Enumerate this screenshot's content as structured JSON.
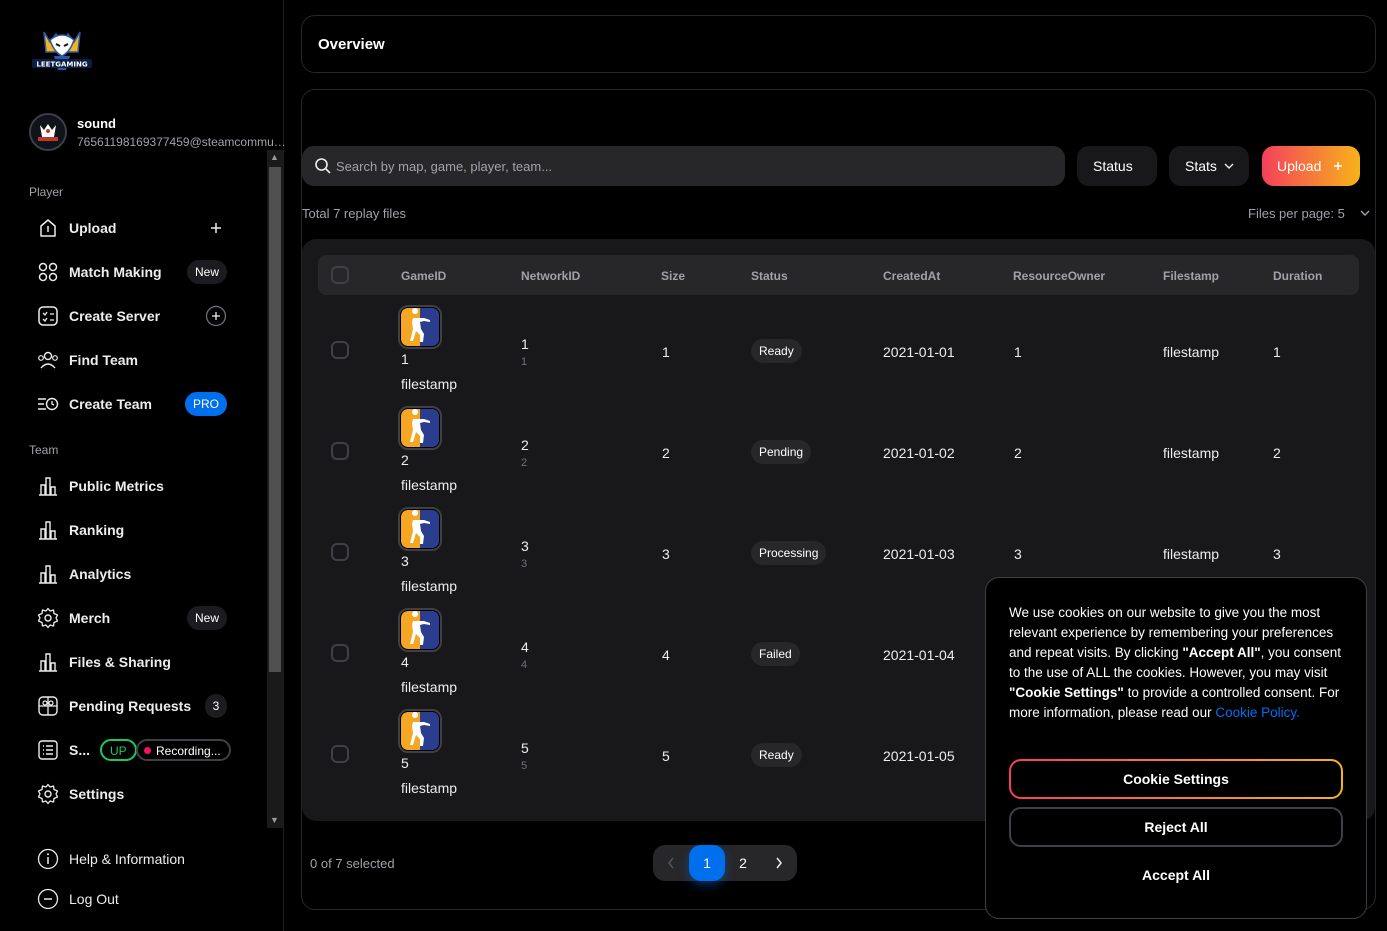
{
  "app": {
    "logo_text": "LEETGAMING"
  },
  "user": {
    "name": "sound",
    "email": "76561198169377459@steamcommunity.com"
  },
  "sidebar": {
    "player_section": "Player",
    "team_section": "Team",
    "player_items": [
      {
        "label": "Upload",
        "icon": "upload-icon"
      },
      {
        "label": "Match Making",
        "icon": "grid-icon",
        "badge": "New"
      },
      {
        "label": "Create Server",
        "icon": "checklist-icon"
      },
      {
        "label": "Find Team",
        "icon": "users-icon"
      },
      {
        "label": "Create Team",
        "icon": "list-clock-icon",
        "badge": "PRO"
      }
    ],
    "team_items": [
      {
        "label": "Public Metrics",
        "icon": "bar-chart-icon"
      },
      {
        "label": "Ranking",
        "icon": "bar-chart-icon"
      },
      {
        "label": "Analytics",
        "icon": "bar-chart-icon"
      },
      {
        "label": "Merch",
        "icon": "gear-icon",
        "badge": "New"
      },
      {
        "label": "Files & Sharing",
        "icon": "bar-chart-icon"
      },
      {
        "label": "Pending Requests",
        "icon": "gift-icon",
        "badge": "3"
      },
      {
        "label": "S...",
        "icon": "document-list-icon",
        "up_chip": "UP",
        "rec_chip": "Recording..."
      },
      {
        "label": "Settings",
        "icon": "gear-icon"
      }
    ],
    "footer_items": [
      {
        "label": "Help & Information",
        "icon": "info-icon"
      },
      {
        "label": "Log Out",
        "icon": "logout-icon"
      }
    ]
  },
  "overview": {
    "title": "Overview"
  },
  "toolbar": {
    "search_placeholder": "Search by map, game, player, team...",
    "status_label": "Status",
    "stats_label": "Stats",
    "upload_label": "Upload",
    "total_text": "Total 7 replay files",
    "per_page_text": "Files per page: 5"
  },
  "table": {
    "headers": [
      "GameID",
      "NetworkID",
      "Size",
      "Status",
      "CreatedAt",
      "ResourceOwner",
      "Filestamp",
      "Duration"
    ],
    "rows": [
      {
        "game_id": "1",
        "game_sub": "filestamp",
        "network_id": "1",
        "network_sub": "1",
        "size": "1",
        "status": "Ready",
        "created_at": "2021-01-01",
        "owner": "1",
        "filestamp": "filestamp",
        "duration": "1"
      },
      {
        "game_id": "2",
        "game_sub": "filestamp",
        "network_id": "2",
        "network_sub": "2",
        "size": "2",
        "status": "Pending",
        "created_at": "2021-01-02",
        "owner": "2",
        "filestamp": "filestamp",
        "duration": "2"
      },
      {
        "game_id": "3",
        "game_sub": "filestamp",
        "network_id": "3",
        "network_sub": "3",
        "size": "3",
        "status": "Processing",
        "created_at": "2021-01-03",
        "owner": "3",
        "filestamp": "filestamp",
        "duration": "3"
      },
      {
        "game_id": "4",
        "game_sub": "filestamp",
        "network_id": "4",
        "network_sub": "4",
        "size": "4",
        "status": "Failed",
        "created_at": "2021-01-04",
        "owner": "",
        "filestamp": "",
        "duration": ""
      },
      {
        "game_id": "5",
        "game_sub": "filestamp",
        "network_id": "5",
        "network_sub": "5",
        "size": "5",
        "status": "Ready",
        "created_at": "2021-01-05",
        "owner": "",
        "filestamp": "",
        "duration": ""
      }
    ]
  },
  "footer": {
    "selected_text": "0 of 7 selected",
    "pages": [
      "1",
      "2"
    ],
    "current_page": "1"
  },
  "cookie": {
    "text_1": "We use cookies on our website to give you the most relevant experience by remembering your preferences and repeat visits. By clicking ",
    "accept_quote": "\"Accept All\"",
    "text_2": ", you consent to the use of ALL the cookies. However, you may visit ",
    "settings_quote": "\"Cookie Settings\"",
    "text_3": " to provide a controlled consent. For more information, please read our ",
    "policy_link": "Cookie Policy.",
    "settings_button": "Cookie Settings",
    "reject_button": "Reject All",
    "accept_button": "Accept All"
  },
  "colors": {
    "primary": "#006FEE",
    "accent_gradient_start": "#f5405c",
    "accent_gradient_end": "#f7b319",
    "success": "#17c964",
    "danger": "#f31260"
  }
}
